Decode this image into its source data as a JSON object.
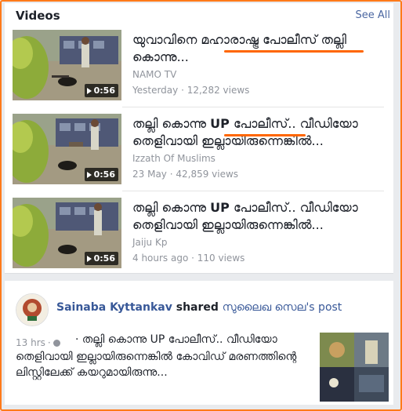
{
  "videos": {
    "title": "Videos",
    "see_all": "See All",
    "items": [
      {
        "title": "യുവാവിനെ മഹാരാഷ്ട്ര പോലീസ് തല്ലി കൊന്നു...",
        "source": "NAMO TV",
        "date": "Yesterday",
        "views": "12,282 views",
        "duration": "0:56"
      },
      {
        "title_prefix": "തല്ലി കൊന്നു ",
        "title_bold": "UP",
        "title_rest": " പോലീസ്.. വീഡിയോ തെളിവായി ഇല്ലായിരുന്നെങ്കിൽ...",
        "source": "Izzath Of Muslims",
        "date": "23 May",
        "views": "42,859 views",
        "duration": "0:56"
      },
      {
        "title_prefix": "തല്ലി കൊന്നു ",
        "title_bold": "UP",
        "title_rest": " പോലീസ്.. വീഡിയോ തെളിവായി ഇല്ലായിരുന്നെങ്കിൽ...",
        "source": "Jaiju Kp",
        "date": "4 hours ago",
        "views": "110 views",
        "duration": "0:56"
      }
    ],
    "separator": " · "
  },
  "post": {
    "author": "Sainaba Kyttankav",
    "action": " shared ",
    "original": "സുലൈഖ സെല's post",
    "time": "13 hrs",
    "meta_sep": " · ",
    "text_line1": "· തല്ലി കൊന്നു UP പോലീസ്.. വീഡിയോ",
    "text_rest": "തെളിവായി ഇല്ലായിരുന്നെങ്കിൽ കോവിഡ് മരണത്തിന്റെ ലിസ്റ്റിലേക്ക് കയറുമായിരുന്നു..."
  },
  "colors": {
    "highlight": "#ff6600",
    "frame": "#ff7a1a",
    "link": "#385898",
    "meta": "#90949c"
  }
}
